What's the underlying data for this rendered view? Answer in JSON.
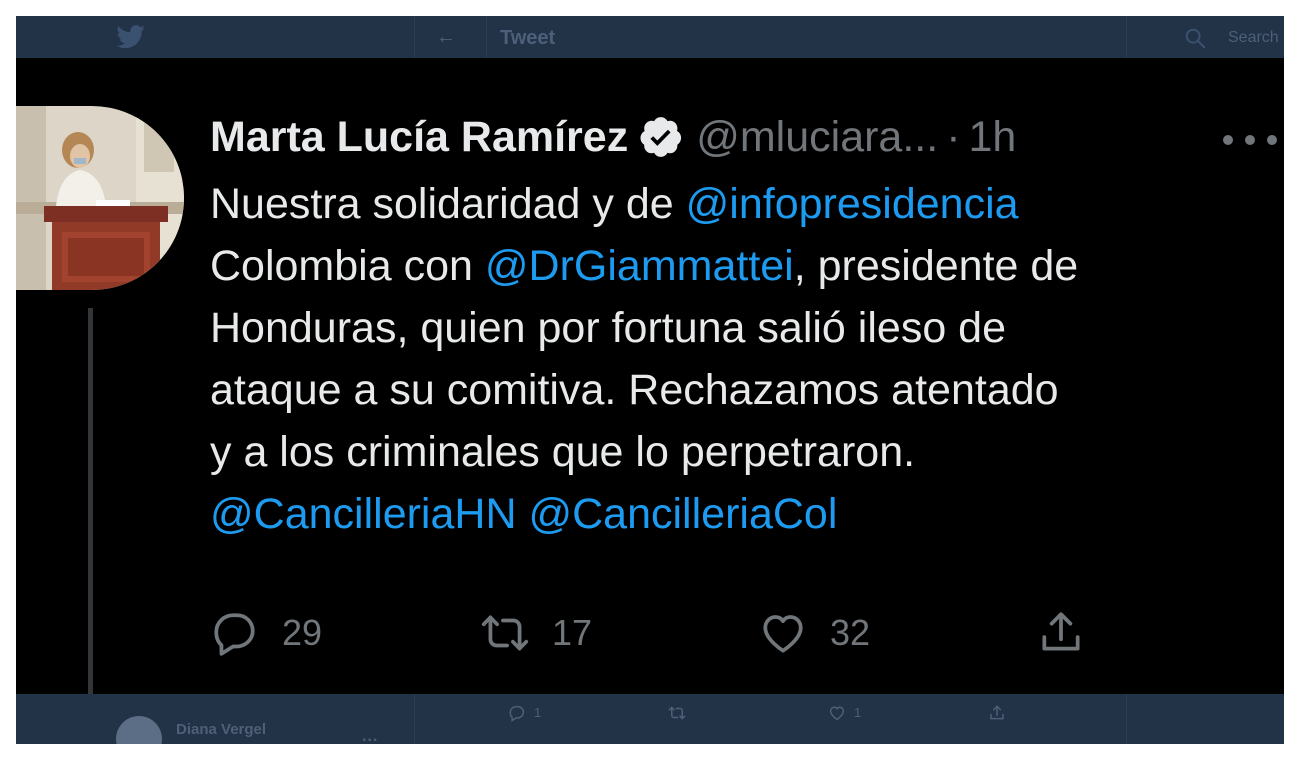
{
  "top_nav": {
    "back_glyph": "←",
    "title": "Tweet",
    "search_placeholder": "Search",
    "logo_icon": "twitter-bird-icon",
    "search_icon": "search-icon"
  },
  "tweet": {
    "author_name": "Marta Lucía Ramírez",
    "verified_icon": "verified-badge-icon",
    "handle": "@mluciara...",
    "separator": "·",
    "time": "1h",
    "more_icon": "more-horizontal-icon",
    "text_lines": [
      [
        {
          "t": "Nuestra solidaridad y de "
        },
        {
          "t": "@infopresidencia",
          "m": true
        }
      ],
      [
        {
          "t": "Colombia con "
        },
        {
          "t": "@DrGiammattei",
          "m": true
        },
        {
          "t": ", presidente de"
        }
      ],
      [
        {
          "t": "Honduras, quien por fortuna salió ileso de"
        }
      ],
      [
        {
          "t": "ataque a su comitiva. Rechazamos atentado"
        }
      ],
      [
        {
          "t": "y a los criminales que lo perpetraron."
        }
      ],
      [
        {
          "t": "@CancilleriaHN",
          "m": true
        },
        {
          "t": " "
        },
        {
          "t": "@CancilleriaCol",
          "m": true
        }
      ]
    ],
    "actions": {
      "reply_count": "29",
      "retweet_count": "17",
      "like_count": "32"
    }
  },
  "next_tweet": {
    "author_name": "Diana Vergel",
    "more": "...",
    "reply_count": "1",
    "like_count": "1"
  },
  "colors": {
    "background": "#000000",
    "primary_text": "#e7e9ea",
    "secondary_text": "#71767b",
    "mention": "#1d9bf0",
    "ghost_bar": "#223247"
  }
}
